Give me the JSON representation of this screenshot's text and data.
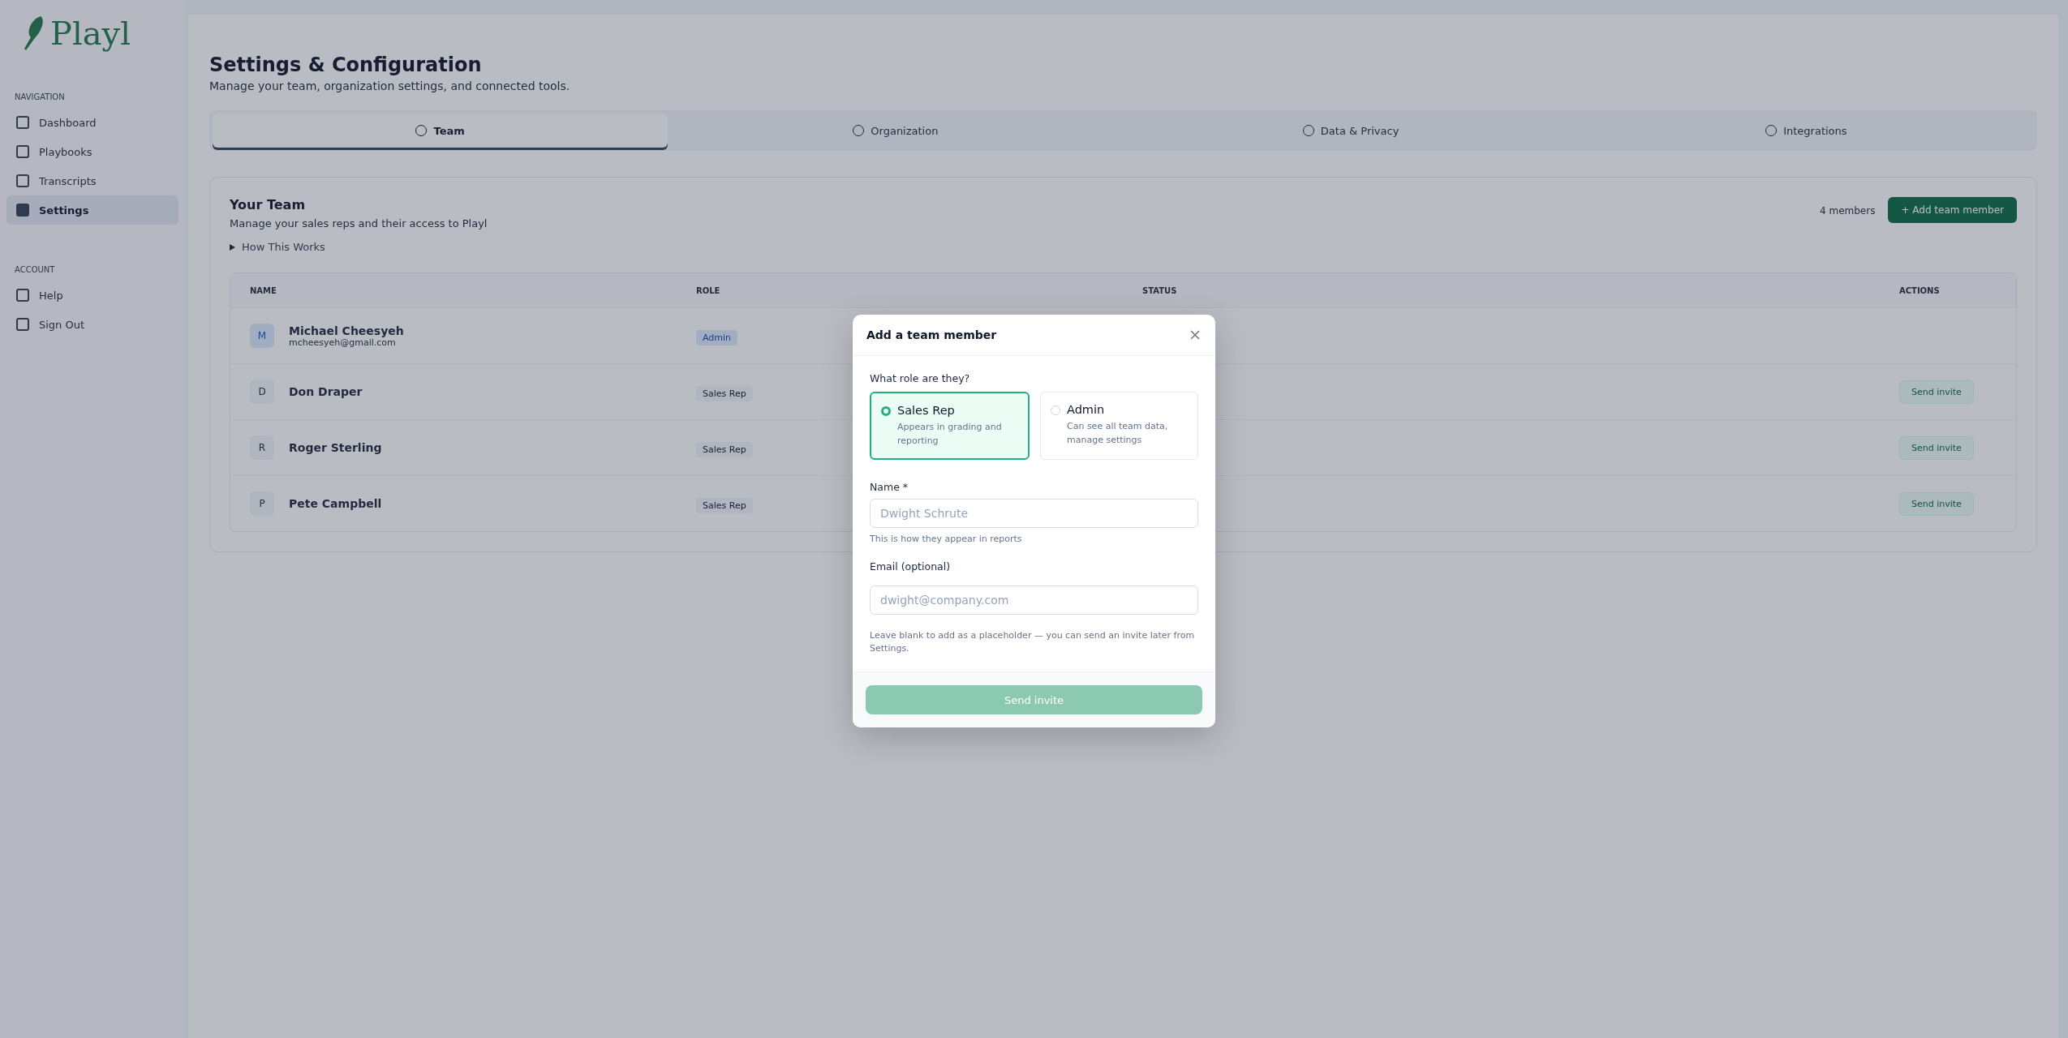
{
  "sidebar": {
    "logo": "Playl",
    "sections": [
      {
        "heading": "NAVIGATION",
        "items": [
          {
            "label": "Dashboard",
            "selected": false
          },
          {
            "label": "Playbooks",
            "selected": false
          },
          {
            "label": "Transcripts",
            "selected": false
          },
          {
            "label": "Settings",
            "selected": true
          }
        ]
      },
      {
        "heading": "ACCOUNT",
        "items": [
          {
            "label": "Help",
            "selected": false
          },
          {
            "label": "Sign Out",
            "selected": false
          }
        ]
      }
    ]
  },
  "page": {
    "title": "Settings & Configuration",
    "subtitle": "Manage your team, organization settings, and connected tools."
  },
  "tabs": [
    {
      "label": "Team",
      "selected": true
    },
    {
      "label": "Organization",
      "selected": false
    },
    {
      "label": "Data & Privacy",
      "selected": false
    },
    {
      "label": "Integrations",
      "selected": false
    }
  ],
  "team": {
    "title": "Your Team",
    "subtitle": "Manage your sales reps and their access to Playl",
    "how_it_works": "How This Works",
    "count": "4 members",
    "add_button": "+ Add team member",
    "columns": [
      "NAME",
      "ROLE",
      "STATUS",
      "ACTIONS"
    ],
    "rows": [
      {
        "initial": "M",
        "name": "Michael Cheesyeh",
        "email": "mcheesyeh@gmail.com",
        "role": "Admin",
        "kind": "admin",
        "action": ""
      },
      {
        "initial": "D",
        "name": "Don Draper",
        "email": "",
        "role": "Sales Rep",
        "kind": "rep",
        "action": "Send invite"
      },
      {
        "initial": "R",
        "name": "Roger Sterling",
        "email": "",
        "role": "Sales Rep",
        "kind": "rep",
        "action": "Send invite"
      },
      {
        "initial": "P",
        "name": "Pete Campbell",
        "email": "",
        "role": "Sales Rep",
        "kind": "rep",
        "action": "Send invite"
      }
    ]
  },
  "modal": {
    "title": "Add a team member",
    "role_question": "What role are they?",
    "roles": [
      {
        "label": "Sales Rep",
        "description": "Appears in grading and reporting",
        "selected": true
      },
      {
        "label": "Admin",
        "description": "Can see all team data, manage settings",
        "selected": false
      }
    ],
    "name_label": "Name *",
    "name_placeholder": "Dwight Schrute",
    "name_hint": "This is how they appear in reports",
    "email_label": "Email (optional)",
    "email_placeholder": "dwight@company.com",
    "email_hint": "Leave blank to add as a placeholder — you can send an invite later from Settings.",
    "submit": "Send invite",
    "submit_disabled": true
  }
}
